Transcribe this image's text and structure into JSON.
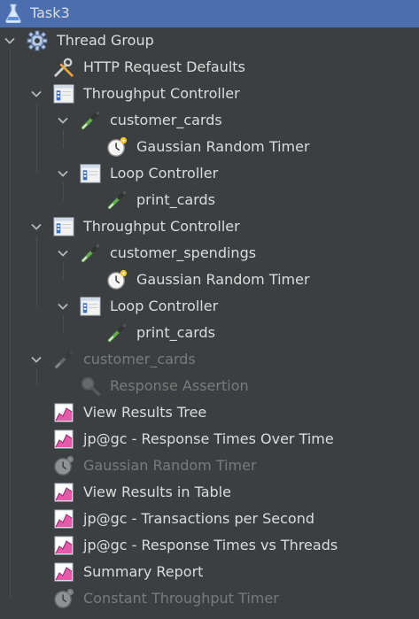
{
  "tree": {
    "nodes": [
      {
        "label": "Task3",
        "icon": "flask-icon",
        "depth": 0,
        "expander": "none",
        "selected": true,
        "disabled": false
      },
      {
        "label": "Thread Group",
        "icon": "gear-icon",
        "depth": 0,
        "expander": "expanded",
        "selected": false,
        "disabled": false
      },
      {
        "label": "HTTP Request Defaults",
        "icon": "wrench-screwdriver-icon",
        "depth": 1,
        "expander": "none",
        "selected": false,
        "disabled": false
      },
      {
        "label": "Throughput Controller",
        "icon": "controller-icon",
        "depth": 1,
        "expander": "expanded",
        "selected": false,
        "disabled": false
      },
      {
        "label": "customer_cards",
        "icon": "pipette-icon",
        "depth": 2,
        "expander": "expanded",
        "selected": false,
        "disabled": false
      },
      {
        "label": "Gaussian Random Timer",
        "icon": "stopwatch-icon",
        "depth": 3,
        "expander": "none",
        "selected": false,
        "disabled": false
      },
      {
        "label": "Loop Controller",
        "icon": "controller-icon",
        "depth": 2,
        "expander": "expanded",
        "selected": false,
        "disabled": false
      },
      {
        "label": "print_cards",
        "icon": "pipette-icon",
        "depth": 3,
        "expander": "none",
        "selected": false,
        "disabled": false
      },
      {
        "label": "Throughput Controller",
        "icon": "controller-icon",
        "depth": 1,
        "expander": "expanded",
        "selected": false,
        "disabled": false
      },
      {
        "label": "customer_spendings",
        "icon": "pipette-icon",
        "depth": 2,
        "expander": "expanded",
        "selected": false,
        "disabled": false
      },
      {
        "label": "Gaussian Random Timer",
        "icon": "stopwatch-icon",
        "depth": 3,
        "expander": "none",
        "selected": false,
        "disabled": false
      },
      {
        "label": "Loop Controller",
        "icon": "controller-icon",
        "depth": 2,
        "expander": "expanded",
        "selected": false,
        "disabled": false
      },
      {
        "label": "print_cards",
        "icon": "pipette-icon",
        "depth": 3,
        "expander": "none",
        "selected": false,
        "disabled": false
      },
      {
        "label": "customer_cards",
        "icon": "pipette-icon",
        "depth": 1,
        "expander": "expanded",
        "selected": false,
        "disabled": true
      },
      {
        "label": "Response Assertion",
        "icon": "magnifier-icon",
        "depth": 2,
        "expander": "none",
        "selected": false,
        "disabled": true
      },
      {
        "label": "View Results Tree",
        "icon": "graph-icon",
        "depth": 1,
        "expander": "none",
        "selected": false,
        "disabled": false
      },
      {
        "label": "jp@gc - Response Times Over Time",
        "icon": "graph-icon",
        "depth": 1,
        "expander": "none",
        "selected": false,
        "disabled": false
      },
      {
        "label": "Gaussian Random Timer",
        "icon": "stopwatch-icon",
        "depth": 1,
        "expander": "none",
        "selected": false,
        "disabled": true
      },
      {
        "label": "View Results in Table",
        "icon": "graph-icon",
        "depth": 1,
        "expander": "none",
        "selected": false,
        "disabled": false
      },
      {
        "label": "jp@gc - Transactions per Second",
        "icon": "graph-icon",
        "depth": 1,
        "expander": "none",
        "selected": false,
        "disabled": false
      },
      {
        "label": "jp@gc - Response Times vs Threads",
        "icon": "graph-icon",
        "depth": 1,
        "expander": "none",
        "selected": false,
        "disabled": false
      },
      {
        "label": "Summary Report",
        "icon": "graph-icon",
        "depth": 1,
        "expander": "none",
        "selected": false,
        "disabled": false
      },
      {
        "label": "Constant Throughput Timer",
        "icon": "stopwatch-icon",
        "depth": 1,
        "expander": "none",
        "selected": false,
        "disabled": true
      }
    ]
  },
  "colors": {
    "background": "#3c3f41",
    "selection": "#4b6eaf",
    "text": "#dcdcdc",
    "disabled_text": "#7a7a7a"
  }
}
